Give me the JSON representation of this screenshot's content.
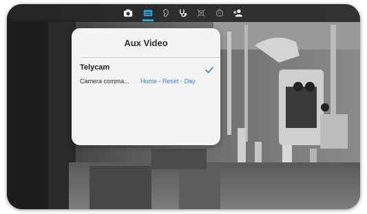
{
  "toolbar": {
    "icons": [
      {
        "name": "camera-icon",
        "active": false
      },
      {
        "name": "aux-video-icon",
        "active": true
      },
      {
        "name": "pointer-icon",
        "active": false
      },
      {
        "name": "stethoscope-icon",
        "active": false
      },
      {
        "name": "resize-icon",
        "active": false
      },
      {
        "name": "robot-icon",
        "active": false
      },
      {
        "name": "add-user-icon",
        "active": false
      }
    ],
    "accent_color": "#29a8e0"
  },
  "popover": {
    "title": "Aux Video",
    "options": [
      {
        "name": "Telycam",
        "selected": true,
        "camera_label": "Camera comma...",
        "commands": [
          "Home",
          "Reset",
          "Day"
        ],
        "separator": "-"
      }
    ]
  },
  "colors": {
    "link": "#2f7fd6",
    "check": "#2f7fd6"
  }
}
